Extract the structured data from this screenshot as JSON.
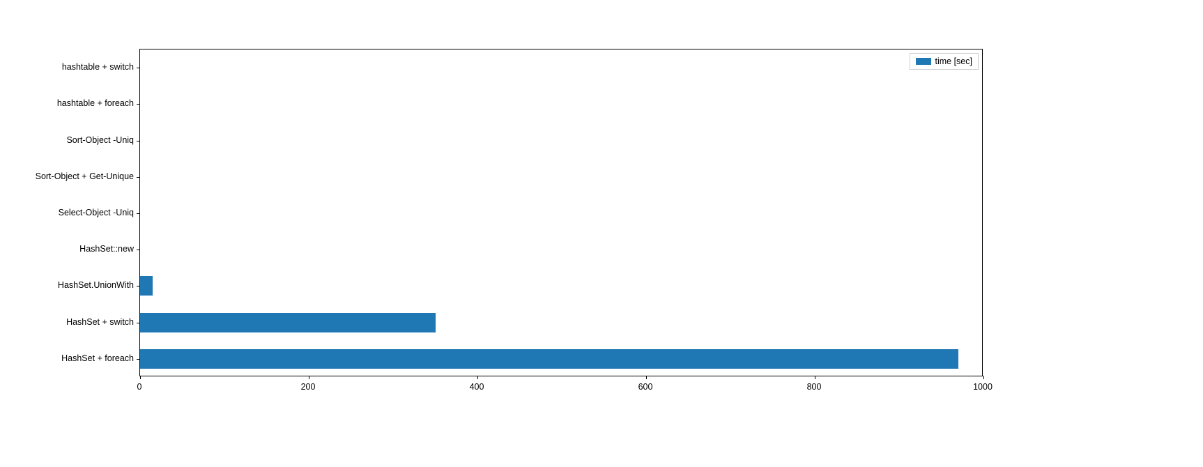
{
  "chart_data": {
    "type": "bar",
    "orientation": "horizontal",
    "categories": [
      "hashtable + switch",
      "hashtable + foreach",
      "Sort-Object -Uniq",
      "Sort-Object + Get-Unique",
      "Select-Object -Uniq",
      "HashSet::new",
      "HashSet.UnionWith",
      "HashSet + switch",
      "HashSet + foreach"
    ],
    "values": [
      0,
      0,
      0,
      0,
      0,
      0,
      15,
      350,
      970
    ],
    "xlim": [
      0,
      1000
    ],
    "xticks": [
      0,
      200,
      400,
      600,
      800,
      1000
    ],
    "legend": "time [sec]",
    "color": "#1f77b4"
  }
}
